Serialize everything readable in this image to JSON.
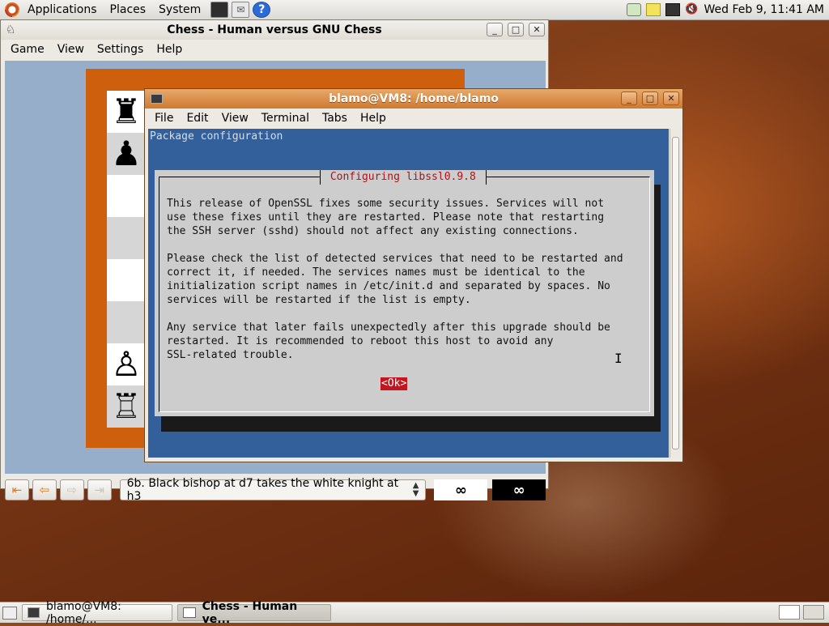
{
  "top_panel": {
    "menus": [
      "Applications",
      "Places",
      "System"
    ],
    "clock": "Wed Feb  9, 11:41 AM",
    "help_glyph": "?"
  },
  "chess_window": {
    "title": "Chess - Human versus GNU Chess",
    "menu": [
      "Game",
      "View",
      "Settings",
      "Help"
    ],
    "board_column": [
      {
        "piece": "♜",
        "shade": "light"
      },
      {
        "piece": "♟",
        "shade": "dark"
      },
      {
        "piece": "",
        "shade": "light"
      },
      {
        "piece": "",
        "shade": "dark"
      },
      {
        "piece": "",
        "shade": "light"
      },
      {
        "piece": "",
        "shade": "dark"
      },
      {
        "piece": "♙",
        "shade": "light"
      },
      {
        "piece": "♖",
        "shade": "dark"
      }
    ],
    "nav_buttons": {
      "first": "⇤",
      "prev": "⇦",
      "next": "⇨",
      "last": "⇥"
    },
    "move_text": "6b. Black bishop at d7 takes the white knight at h3",
    "white_clock": "∞",
    "black_clock": "∞"
  },
  "terminal_window": {
    "title": "blamo@VM8: /home/blamo",
    "menu": [
      "File",
      "Edit",
      "View",
      "Terminal",
      "Tabs",
      "Help"
    ],
    "package_config_title": "Package configuration",
    "dialog": {
      "title": " Configuring libssl0.9.8 ",
      "paragraph1": "This release of OpenSSL fixes some security issues. Services will not\nuse these fixes until they are restarted. Please note that restarting\nthe SSH server (sshd) should not affect any existing connections.",
      "paragraph2": "Please check the list of detected services that need to be restarted and\ncorrect it, if needed. The services names must be identical to the\ninitialization script names in /etc/init.d and separated by spaces. No\nservices will be restarted if the list is empty.",
      "paragraph3": "Any service that later fails unexpectedly after this upgrade should be\nrestarted. It is recommended to reboot this host to avoid any\nSSL-related trouble.",
      "ok_label": "<Ok>"
    }
  },
  "window_buttons": {
    "minimize": "_",
    "maximize": "□",
    "close": "✕"
  },
  "taskbar": {
    "tasks": [
      {
        "label": "blamo@VM8: /home/..."
      },
      {
        "label": "Chess - Human ve..."
      }
    ]
  },
  "colors": {
    "terminal_bg": "#335f9a",
    "dialog_bg": "#cdcdcd",
    "dialog_title": "#b0111b",
    "ok_button": "#c4141f",
    "board_frame": "#ce5f0d"
  }
}
